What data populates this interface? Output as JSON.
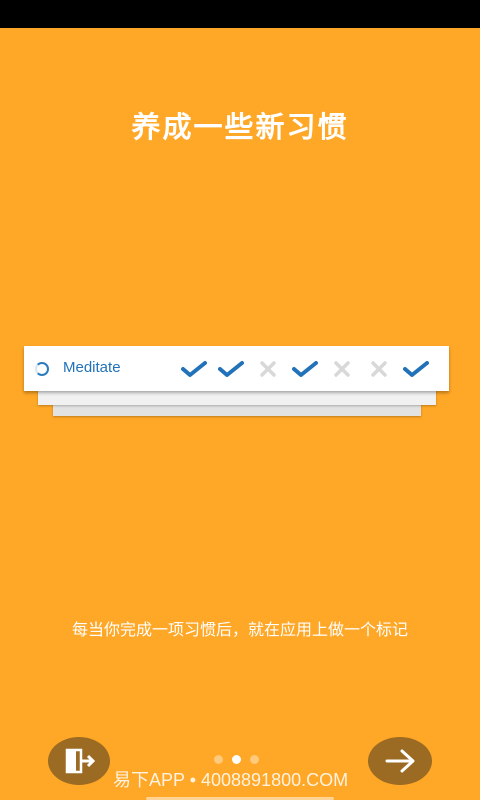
{
  "title": "养成一些新习惯",
  "habit": {
    "name": "Meditate",
    "icon": "progress-ring-icon",
    "days": [
      {
        "status": "done",
        "icon": "check-icon"
      },
      {
        "status": "done",
        "icon": "check-icon"
      },
      {
        "status": "missed",
        "icon": "cross-icon"
      },
      {
        "status": "done",
        "icon": "check-icon"
      },
      {
        "status": "missed",
        "icon": "cross-icon"
      },
      {
        "status": "missed",
        "icon": "cross-icon"
      },
      {
        "status": "done",
        "icon": "check-icon"
      }
    ]
  },
  "description": "每当你完成一项习惯后，就在应用上做一个标记",
  "pager": {
    "total": 3,
    "current": 2
  },
  "buttons": {
    "skip_icon": "exit-door-icon",
    "next_icon": "arrow-right-icon"
  },
  "watermark": "易下APP • 4008891800.COM",
  "colors": {
    "background": "#FFA726",
    "accent": "#2272B9",
    "missed": "#D8D8D8",
    "button": "#9B6A23"
  }
}
